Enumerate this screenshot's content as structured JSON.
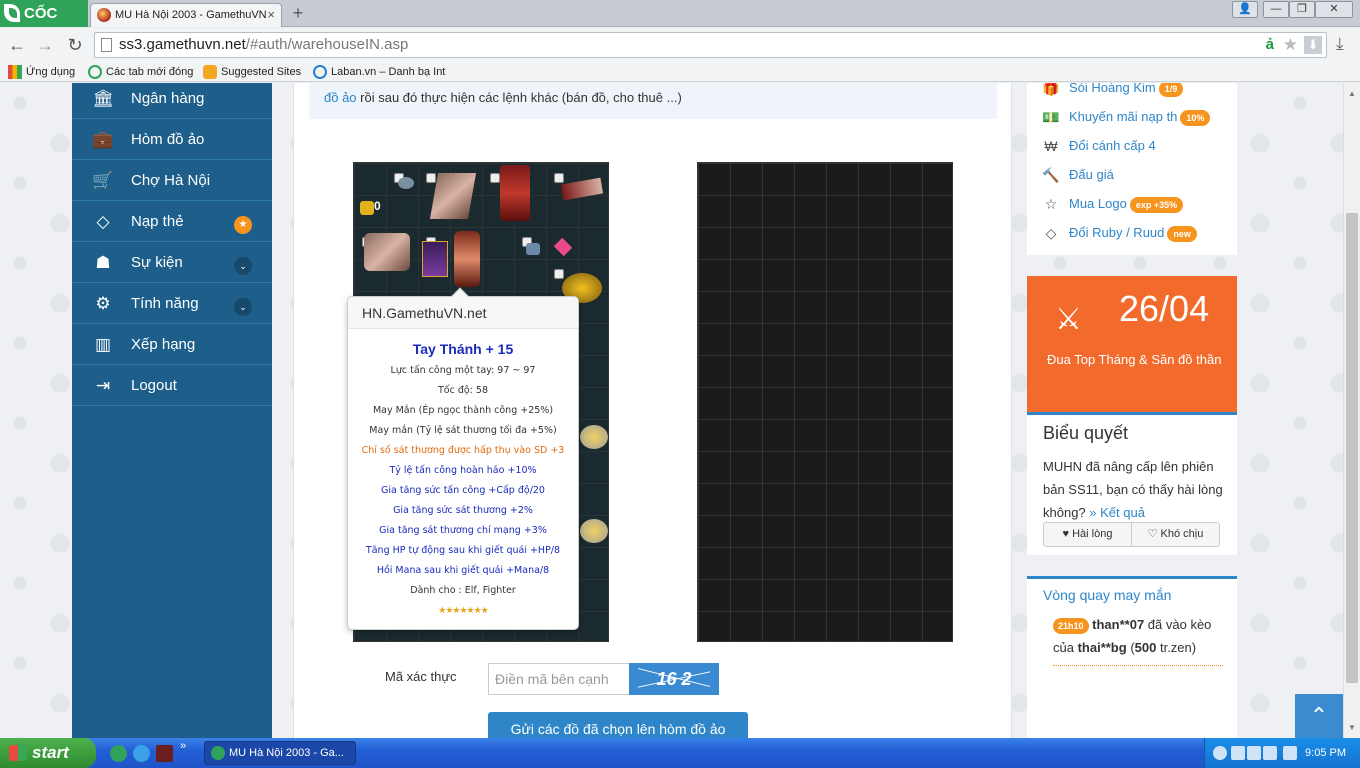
{
  "browser": {
    "app_name": "CỐC CỐC",
    "tab_title": "MU Hà Nội 2003 - GamethuVN",
    "url_host": "ss3.gamethuvn.net",
    "url_path": "/#auth/warehouseIN.asp",
    "window_buttons": {
      "user": "👤",
      "minimize": "—",
      "maximize": "❐",
      "close": "✕"
    },
    "bookmarks": [
      "Ứng dụng",
      "Các tab mới đóng",
      "Suggested Sites",
      "Laban.vn – Danh bạ Int"
    ]
  },
  "sidebar": {
    "items": [
      {
        "label": "Ngân hàng",
        "icon": "bank-icon"
      },
      {
        "label": "Hòm đồ ảo",
        "icon": "briefcase-icon"
      },
      {
        "label": "Chợ Hà Nội",
        "icon": "cart-icon"
      },
      {
        "label": "Nạp thẻ",
        "icon": "diamond-icon",
        "badge": "★"
      },
      {
        "label": "Sự kiện",
        "icon": "android-icon",
        "badge": "⌄"
      },
      {
        "label": "Tính năng",
        "icon": "cogs-icon",
        "badge": "⌄"
      },
      {
        "label": "Xếp hạng",
        "icon": "bar-chart-icon"
      },
      {
        "label": "Logout",
        "icon": "sign-out-icon"
      }
    ]
  },
  "notice": {
    "link_text": "đồ ảo",
    "rest_text": " rồi sau đó thực hiện các lệnh khác (bán đồ, cho thuê ...)"
  },
  "tooltip": {
    "header": "HN.GamethuVN.net",
    "item_name": "Tay Thánh + 15",
    "lines": [
      {
        "text": "Lực tấn công một tay: 97 ~ 97",
        "style": "normal"
      },
      {
        "text": "Tốc độ: 58",
        "style": "normal"
      },
      {
        "text": "May Mắn (Ép ngọc thành công +25%)",
        "style": "normal"
      },
      {
        "text": "May mắn (Tỷ lệ sát thương tối đa +5%)",
        "style": "normal"
      },
      {
        "text": "Chỉ số sát thương được hấp thụ vào SD +3",
        "style": "orange"
      },
      {
        "text": "Tỷ lệ tấn công hoàn hảo +10%",
        "style": "blue"
      },
      {
        "text": "Gia tăng sức tấn công +Cấp độ/20",
        "style": "blue"
      },
      {
        "text": "Gia tăng sức sát thương +2%",
        "style": "blue"
      },
      {
        "text": "Gia tăng sát thương chí mạng +3%",
        "style": "blue"
      },
      {
        "text": "Tăng HP tự động sau khi giết quái +HP/8",
        "style": "blue"
      },
      {
        "text": "Hồi Mana sau khi giết quái +Mana/8",
        "style": "blue"
      },
      {
        "text": "Dành cho : Elf, Fighter",
        "style": "normal"
      }
    ],
    "stars": "★★★★★★★",
    "star_color": "#e8a317"
  },
  "grid": {
    "zen_count": "0"
  },
  "captcha": {
    "label": "Mã xác thực",
    "placeholder": "Điền mã bên cạnh",
    "image_text": "16 2"
  },
  "submit_label": "Gửi các đồ đã chọn lên hòm đồ ảo",
  "right_links": [
    {
      "label": "Sói Hoàng Kim",
      "badge": "1/9",
      "icon": "gift-icon"
    },
    {
      "label": "Khuyến mãi nạp th",
      "badge": "10%",
      "icon": "money-icon"
    },
    {
      "label": "Đổi cánh cấp 4",
      "badge": "",
      "icon": "won-icon"
    },
    {
      "label": "Đấu giá",
      "badge": "",
      "icon": "gavel-icon"
    },
    {
      "label": "Mua Logo",
      "badge": "exp +35%",
      "icon": "star-outline-icon"
    },
    {
      "label": "Đổi Ruby / Ruud",
      "badge": "new",
      "icon": "diamond-icon"
    }
  ],
  "event": {
    "date": "26/04",
    "text": "Đua Top Tháng & Săn đồ thần",
    "color": "#f26b2c"
  },
  "poll": {
    "title": "Biểu quyết",
    "text": "MUHN đã nâng cấp lên phiên bản SS11, bạn có thấy hài lòng không?",
    "result_link": "» Kết quả",
    "yes_label": "♥ Hài lòng",
    "no_label": "♡ Khó chịu"
  },
  "wheel": {
    "title": "Vòng quay may mắn",
    "time": "21h10",
    "user1": "than**07",
    "mid": " đã vào kèo của ",
    "user2": "thai**bg",
    "amount_prefix": " (",
    "amount": "500",
    "amount_suffix": " tr.zen)"
  },
  "taskbar": {
    "start": "start",
    "window_label": "MU Hà Nội 2003 - Ga...",
    "clock": "9:05 PM"
  },
  "colors": {
    "sidebar": "#1d5f8a",
    "accent": "#2e86c8",
    "badge": "#f7941d"
  }
}
